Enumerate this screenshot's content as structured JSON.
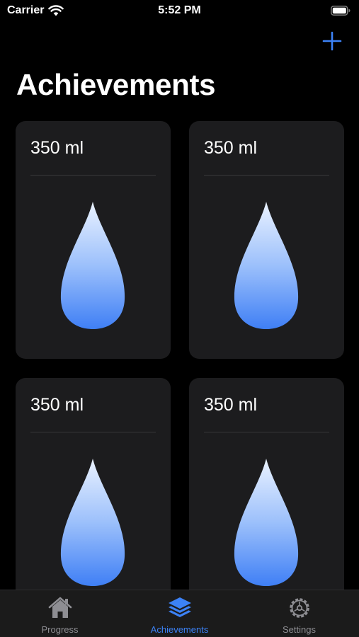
{
  "status_bar": {
    "carrier": "Carrier",
    "time": "5:52 PM"
  },
  "header": {
    "title": "Achievements",
    "add_icon": "plus-icon"
  },
  "cards": [
    {
      "amount": "350 ml",
      "icon": "water-drop-icon"
    },
    {
      "amount": "350 ml",
      "icon": "water-drop-icon"
    },
    {
      "amount": "350 ml",
      "icon": "water-drop-icon"
    },
    {
      "amount": "350 ml",
      "icon": "water-drop-icon"
    }
  ],
  "tab_bar": {
    "tabs": [
      {
        "label": "Progress",
        "icon": "house-icon",
        "active": false
      },
      {
        "label": "Achievements",
        "icon": "stack-icon",
        "active": true
      },
      {
        "label": "Settings",
        "icon": "gear-icon",
        "active": false
      }
    ]
  },
  "colors": {
    "accent": "#3c82f6",
    "background": "#000000",
    "card": "#1c1c1e",
    "inactive_tab": "#8e8e93",
    "drop_top": "#eaf2ff",
    "drop_bottom": "#3f7ff5"
  }
}
